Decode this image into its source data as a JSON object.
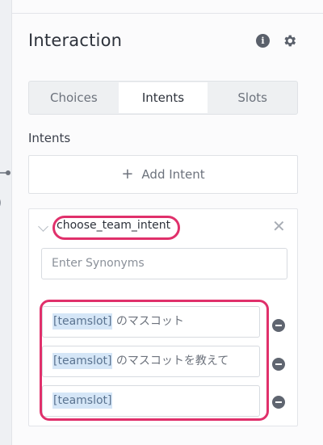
{
  "panel": {
    "title": "Interaction",
    "info_icon": "info-icon",
    "settings_icon": "gear-icon"
  },
  "tabs": [
    {
      "label": "Choices",
      "active": false
    },
    {
      "label": "Intents",
      "active": true
    },
    {
      "label": "Slots",
      "active": false
    }
  ],
  "intents_section": {
    "label": "Intents",
    "add_label": "Add Intent"
  },
  "intent_card": {
    "name": "choose_team_intent",
    "synonym_placeholder": "Enter Synonyms",
    "utterances": [
      {
        "slot": "[teamslot]",
        "text": " のマスコット"
      },
      {
        "slot": "[teamslot]",
        "text": " のマスコットを教えて"
      },
      {
        "slot": "[teamslot]",
        "text": ""
      }
    ]
  },
  "colors": {
    "highlight": "#e0306b",
    "slot_tag_bg": "#d5e6f7"
  }
}
